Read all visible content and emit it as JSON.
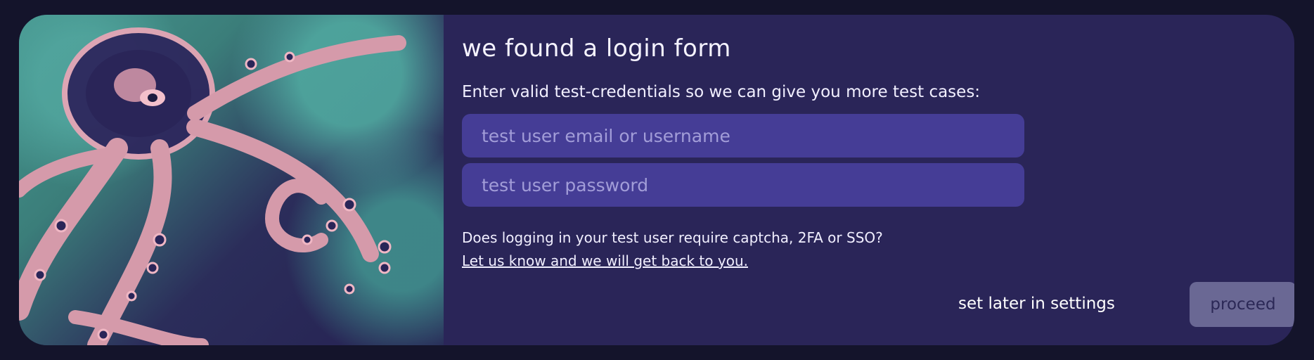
{
  "dialog": {
    "title": "we found a login form",
    "subtitle": "Enter valid test-credentials so we can give you more test cases:",
    "fields": {
      "email_placeholder": "test user email or username",
      "email_value": "",
      "password_placeholder": "test user password",
      "password_value": ""
    },
    "help_question": "Does logging in your test user require captcha, 2FA or SSO?",
    "help_link": "Let us know and we will get back to you.",
    "actions": {
      "later_label": "set later in settings",
      "proceed_label": "proceed"
    }
  },
  "illustration": {
    "subject": "octopus-illustration"
  },
  "colors": {
    "page_background": "#14142b",
    "card_background": "#2a2558",
    "input_background": "#453d96",
    "input_placeholder": "#a29dd8",
    "proceed_background": "#6a6894",
    "text": "#f1efff",
    "art_teal": "#4a9a92",
    "art_pink": "#e5a6b6"
  }
}
